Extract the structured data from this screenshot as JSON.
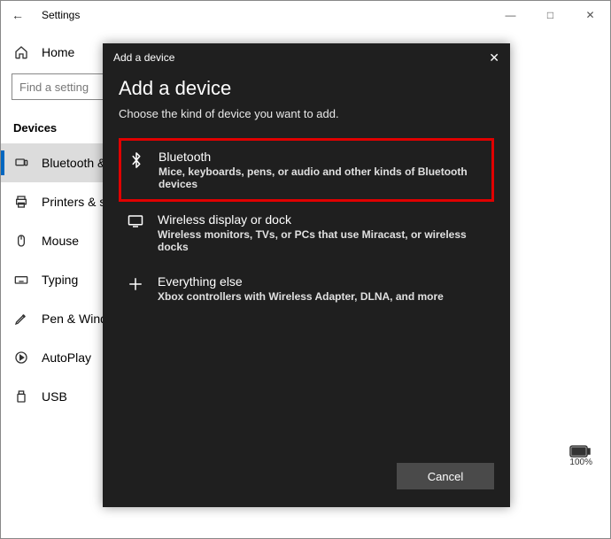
{
  "settings": {
    "title": "Settings",
    "home": "Home",
    "search_placeholder": "Find a setting",
    "section": "Devices",
    "nav": [
      {
        "label": "Bluetooth & other devices"
      },
      {
        "label": "Printers & scanners"
      },
      {
        "label": "Mouse"
      },
      {
        "label": "Typing"
      },
      {
        "label": "Pen & Windows Ink"
      },
      {
        "label": "AutoPlay"
      },
      {
        "label": "USB"
      }
    ],
    "battery_pct": "100%"
  },
  "dialog": {
    "titlebar": "Add a device",
    "heading": "Add a device",
    "subtitle": "Choose the kind of device you want to add.",
    "options": [
      {
        "title": "Bluetooth",
        "desc": "Mice, keyboards, pens, or audio and other kinds of Bluetooth devices"
      },
      {
        "title": "Wireless display or dock",
        "desc": "Wireless monitors, TVs, or PCs that use Miracast, or wireless docks"
      },
      {
        "title": "Everything else",
        "desc": "Xbox controllers with Wireless Adapter, DLNA, and more"
      }
    ],
    "cancel": "Cancel"
  }
}
